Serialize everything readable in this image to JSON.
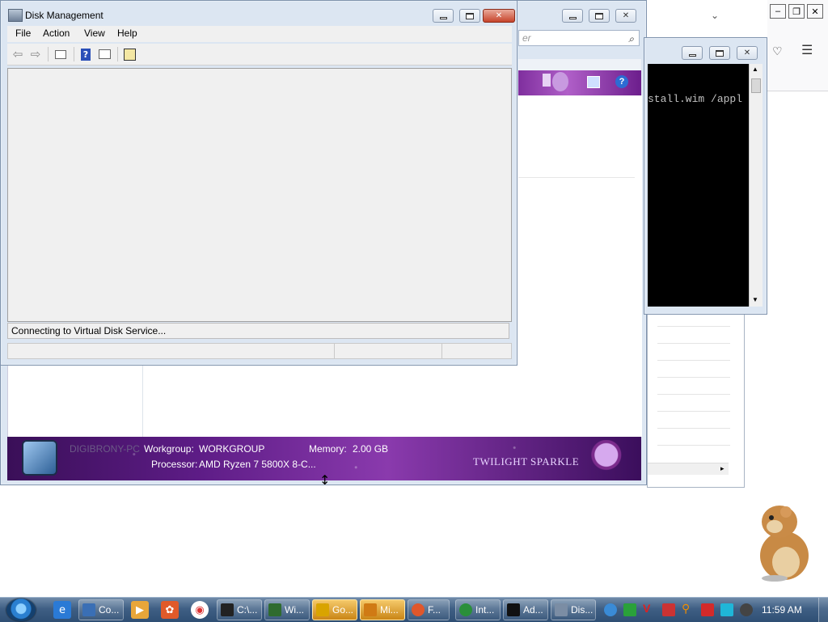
{
  "background_explorer": {
    "search_placeholder": "er",
    "banner": {
      "computer_name": "DIGIBRONY-PC",
      "workgroup_label": "Workgroup:",
      "workgroup_value": "WORKGROUP",
      "memory_label": "Memory:",
      "memory_value": "2.00 GB",
      "processor_label": "Processor:",
      "processor_value": "AMD Ryzen 7 5800X 8-C...",
      "logo_text": "TWILIGHT SPARKLE"
    }
  },
  "cmd_window": {
    "text_line": "stall.wim /appl"
  },
  "disk_management": {
    "title": "Disk Management",
    "menu": [
      "File",
      "Action",
      "View",
      "Help"
    ],
    "status_message": "Connecting to Virtual Disk Service..."
  },
  "taskbar": {
    "tasks": [
      {
        "label": "Co...",
        "color": "#3a6fb5"
      },
      {
        "label": "C:\\...",
        "color": "#222222"
      },
      {
        "label": "Wi...",
        "color": "#2f6b2f"
      },
      {
        "label": "Go...",
        "color": "#d9a400",
        "active": true
      },
      {
        "label": "Mi...",
        "color": "#d07a14",
        "active": true
      },
      {
        "label": "F...",
        "color": "#e0572b"
      },
      {
        "label": "Int...",
        "color": "#2a8f3a"
      },
      {
        "label": "Ad...",
        "color": "#111111"
      },
      {
        "label": "Dis...",
        "color": "#7b8da4"
      }
    ],
    "clock": "11:59 AM"
  }
}
